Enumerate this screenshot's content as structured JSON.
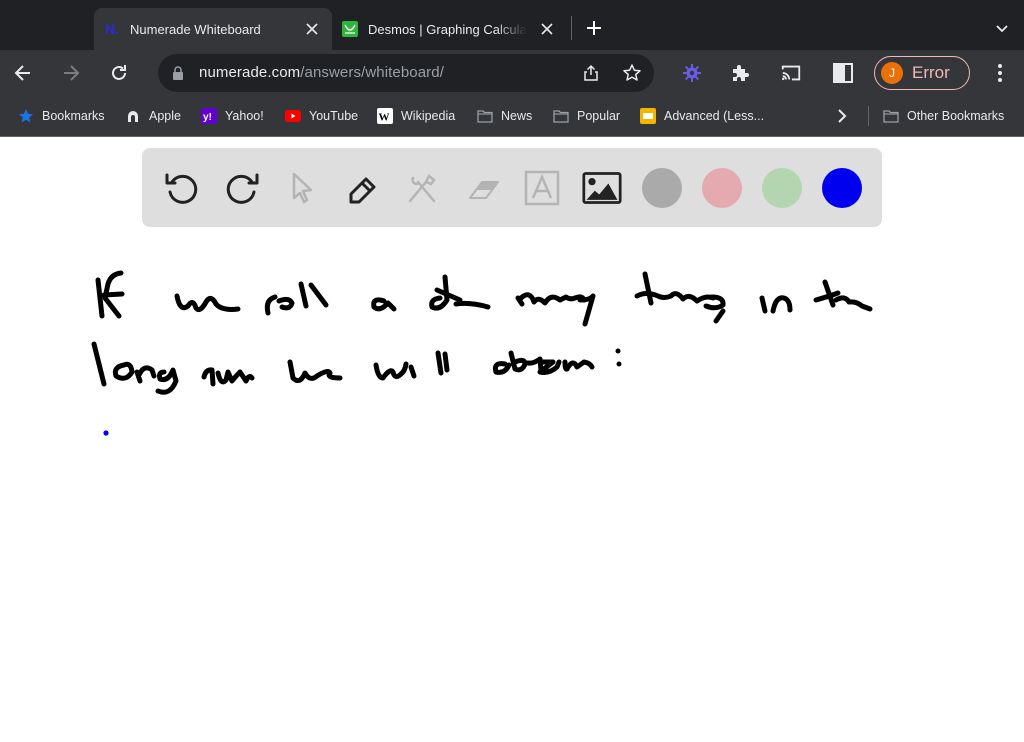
{
  "browser": {
    "tabs": [
      {
        "title": "Numerade Whiteboard",
        "favicon": "numerade-icon",
        "active": true
      },
      {
        "title": "Desmos | Graphing Calculator",
        "favicon": "desmos-icon",
        "active": false
      }
    ],
    "address_bar": {
      "domain": "numerade.com",
      "path": "/answers/whiteboard/"
    },
    "profile": {
      "initial": "J",
      "status": "Error"
    },
    "bookmarks": [
      {
        "label": "Bookmarks",
        "icon": "star-icon"
      },
      {
        "label": "Apple",
        "icon": "apple-icon"
      },
      {
        "label": "Yahoo!",
        "icon": "yahoo-icon"
      },
      {
        "label": "YouTube",
        "icon": "youtube-icon"
      },
      {
        "label": "Wikipedia",
        "icon": "wikipedia-icon"
      },
      {
        "label": "News",
        "icon": "folder-icon"
      },
      {
        "label": "Popular",
        "icon": "folder-icon"
      },
      {
        "label": "Advanced (Less...",
        "icon": "slides-icon"
      }
    ],
    "other_bookmarks": "Other Bookmarks"
  },
  "whiteboard": {
    "tools": [
      {
        "name": "undo",
        "enabled": true
      },
      {
        "name": "redo",
        "enabled": true
      },
      {
        "name": "select",
        "enabled": false
      },
      {
        "name": "pen",
        "enabled": true,
        "selected": true
      },
      {
        "name": "tools",
        "enabled": false
      },
      {
        "name": "eraser",
        "enabled": false
      },
      {
        "name": "text",
        "enabled": false
      },
      {
        "name": "image",
        "enabled": true
      }
    ],
    "colors": [
      {
        "name": "gray",
        "hex": "#aaaaaa"
      },
      {
        "name": "pink",
        "hex": "#e5a9b0"
      },
      {
        "name": "green",
        "hex": "#b3d6b1"
      },
      {
        "name": "blue",
        "hex": "#0000ee",
        "selected": true
      }
    ],
    "handwritten_text": {
      "line1": "If we roll a die many times, in the",
      "line2": "long run we will obtain :"
    },
    "pen_color": "#000000",
    "dot_color": "#0000ee"
  }
}
